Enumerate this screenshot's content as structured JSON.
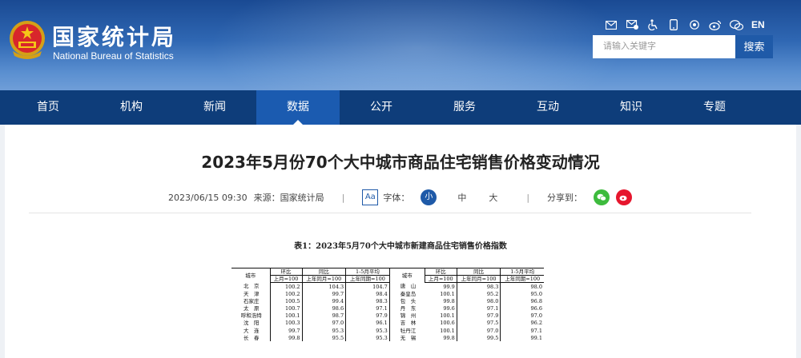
{
  "header": {
    "logo_cn": "国家统计局",
    "logo_en": "National Bureau of Statistics",
    "lang": "EN",
    "search_placeholder": "请输入关键字",
    "search_button": "搜索",
    "icons": [
      "mail-icon",
      "mail-check-icon",
      "accessibility-icon",
      "mobile-icon",
      "eye-icon",
      "weibo-icon",
      "wechat-icon"
    ]
  },
  "nav": {
    "items": [
      "首页",
      "机构",
      "新闻",
      "数据",
      "公开",
      "服务",
      "互动",
      "知识",
      "专题"
    ],
    "active": "数据"
  },
  "article": {
    "title": "2023年5月份70个大中城市商品住宅销售价格变动情况",
    "date": "2023/06/15 09:30",
    "source": "来源：国家统计局",
    "aa": "Aa",
    "font_label": "字体：",
    "font_small": "小",
    "font_medium": "中",
    "font_large": "大",
    "share_label": "分享到："
  },
  "table": {
    "caption": "表1：2023年5月70个大中城市新建商品住宅销售价格指数",
    "headers": {
      "city": "城市",
      "mom": "环比",
      "yoy": "同比",
      "avg": "1-5月平均",
      "mom_base": "上月=100",
      "yoy_base": "上年同月=100",
      "avg_base": "上年同期=100"
    },
    "rows": [
      [
        "北　京",
        "100.2",
        "104.3",
        "104.7",
        "唐　山",
        "99.9",
        "98.3",
        "98.0"
      ],
      [
        "天　津",
        "100.2",
        "99.7",
        "98.4",
        "秦皇岛",
        "100.1",
        "95.2",
        "95.0"
      ],
      [
        "石家庄",
        "100.5",
        "99.4",
        "98.3",
        "包　头",
        "99.8",
        "98.0",
        "96.8"
      ],
      [
        "太　原",
        "100.7",
        "98.6",
        "97.1",
        "丹　东",
        "99.6",
        "97.1",
        "96.6"
      ],
      [
        "呼和浩特",
        "100.1",
        "98.7",
        "97.9",
        "锦　州",
        "100.1",
        "97.9",
        "97.0"
      ],
      [
        "沈　阳",
        "100.3",
        "97.0",
        "96.1",
        "吉　林",
        "100.6",
        "97.5",
        "96.2"
      ],
      [
        "大　连",
        "99.7",
        "95.3",
        "95.3",
        "牡丹江",
        "100.1",
        "97.0",
        "97.1"
      ],
      [
        "长　春",
        "99.8",
        "95.5",
        "95.3",
        "无　锡",
        "99.8",
        "99.5",
        "99.1"
      ]
    ]
  },
  "colors": {
    "nav_bg": "#0e3d7a",
    "nav_active": "#1b5bb0",
    "brand_blue": "#1f5aa8",
    "wechat_green": "#3dbb3d",
    "weibo_red": "#e6162d"
  }
}
